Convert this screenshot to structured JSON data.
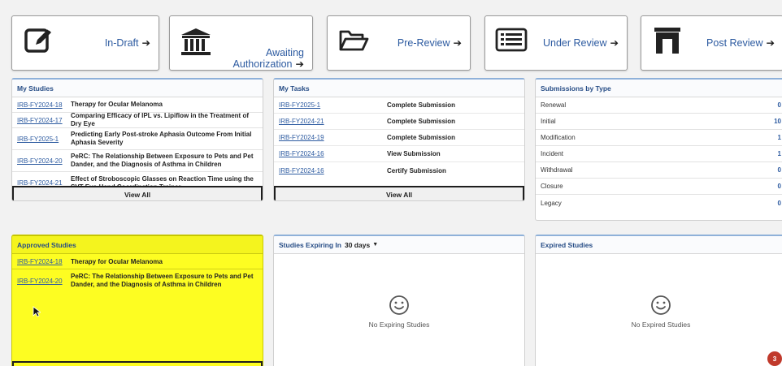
{
  "status_cards": {
    "in_draft": "In-Draft",
    "awaiting_line1": "Awaiting",
    "awaiting_line2": "Authorization",
    "prereview": "Pre-Review",
    "under_review": "Under Review",
    "post_review": "Post Review",
    "arrow": "➔"
  },
  "my_studies": {
    "title": "My Studies",
    "rows": [
      {
        "id": "IRB-FY2024-18",
        "title": "Therapy for Ocular Melanoma"
      },
      {
        "id": "IRB-FY2024-17",
        "title": "Comparing Efficacy of IPL vs. Lipiflow in the Treatment of Dry Eye"
      },
      {
        "id": "IRB-FY2025-1",
        "title": "Predicting Early Post-stroke Aphasia Outcome From Initial Aphasia Severity"
      },
      {
        "id": "IRB-FY2024-20",
        "title": "PeRC: The Relationship Between Exposure to Pets and Pet Dander, and the Diagnosis of Asthma in Children"
      },
      {
        "id": "IRB-FY2024-21",
        "title": "Effect of Stroboscopic Glasses on Reaction Time using the SVT Eye-Hand Coordination Trainer"
      }
    ],
    "view_all": "View All"
  },
  "my_tasks": {
    "title": "My Tasks",
    "rows": [
      {
        "id": "IRB-FY2025-1",
        "task": "Complete Submission"
      },
      {
        "id": "IRB-FY2024-21",
        "task": "Complete Submission"
      },
      {
        "id": "IRB-FY2024-19",
        "task": "Complete Submission"
      },
      {
        "id": "IRB-FY2024-16",
        "task": "View Submission"
      },
      {
        "id": "IRB-FY2024-16",
        "task": "Certify Submission"
      }
    ],
    "view_all": "View All"
  },
  "submissions_by_type": {
    "title": "Submissions by Type",
    "rows": [
      {
        "name": "Renewal",
        "value": "0"
      },
      {
        "name": "Initial",
        "value": "10"
      },
      {
        "name": "Modification",
        "value": "1"
      },
      {
        "name": "Incident",
        "value": "1"
      },
      {
        "name": "Withdrawal",
        "value": "0"
      },
      {
        "name": "Closure",
        "value": "0"
      },
      {
        "name": "Legacy",
        "value": "0"
      }
    ]
  },
  "approved_studies": {
    "title": "Approved Studies",
    "rows": [
      {
        "id": "IRB-FY2024-18",
        "title": "Therapy for Ocular Melanoma"
      },
      {
        "id": "IRB-FY2024-20",
        "title": "PeRC: The Relationship Between Exposure to Pets and Pet Dander, and the Diagnosis of Asthma in Children"
      }
    ]
  },
  "expiring": {
    "title": "Studies Expiring In",
    "selected": "30 days",
    "empty": "No Expiring Studies"
  },
  "expired": {
    "title": "Expired Studies",
    "empty": "No Expired Studies"
  },
  "notification_count": "3",
  "colors": {
    "link": "#2c5aa0",
    "highlight": "#fdfd22",
    "badge": "#c0392b"
  }
}
